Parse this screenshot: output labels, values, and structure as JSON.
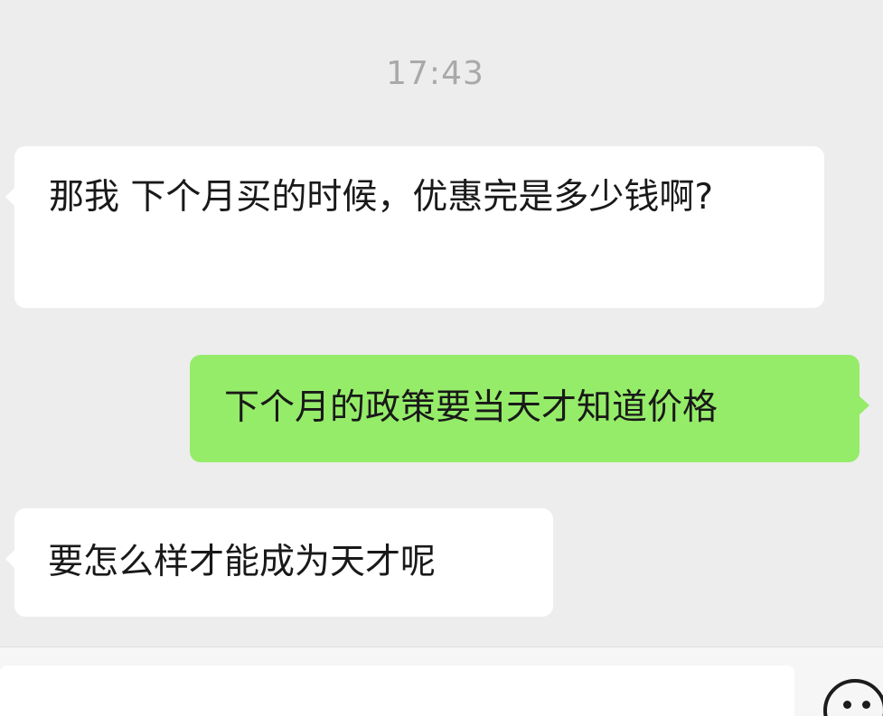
{
  "chat": {
    "timestamp": "17:43",
    "messages": [
      {
        "direction": "incoming",
        "text": "那我 下个月买的时候，优惠完是多少钱啊?"
      },
      {
        "direction": "outgoing",
        "text": "下个月的政策要当天才知道价格"
      },
      {
        "direction": "incoming",
        "text": "要怎么样才能成为天才呢"
      }
    ]
  },
  "input_bar": {
    "value": "",
    "emoji_icon": "smiley-face-icon"
  },
  "colors": {
    "background": "#ededed",
    "incoming_bubble": "#ffffff",
    "outgoing_bubble": "#95ec69",
    "timestamp_text": "#a9a9a9",
    "message_text": "#191919"
  }
}
